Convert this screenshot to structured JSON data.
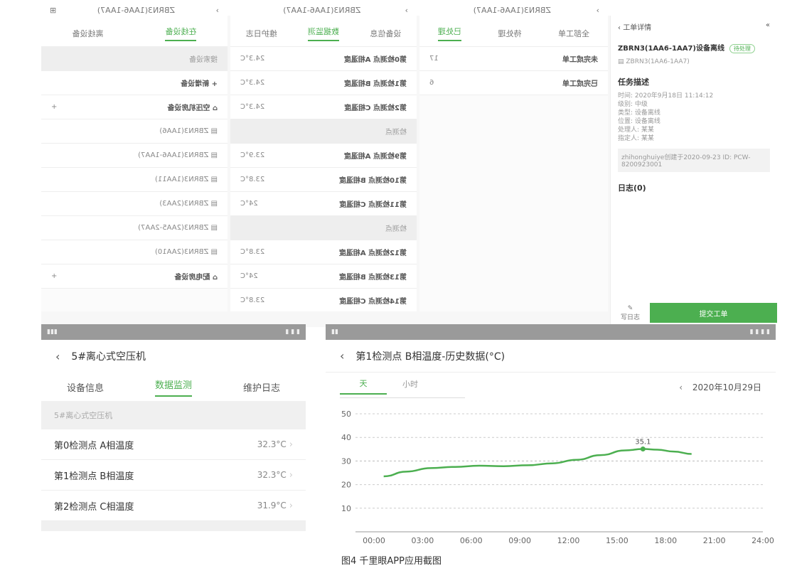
{
  "caption": "图4 千里眼APP应用截图",
  "top_detail": {
    "header": "工单详情",
    "device": "ZBRN3(1AA6-1AA7)设备离线",
    "tag": "待处理",
    "subtitle": "ZBRN3(1AA6-1AA7)",
    "section_desc": "任务描述",
    "desc_lines": [
      "时间: 2020年9月18日 11:14:12",
      "级别: 中级",
      "类型: 设备离线",
      "位置: 设备离线",
      "处理人: 某某",
      "指定人: 某某"
    ],
    "record": "zhihonghuiye创建于2020-09-23 ID: PCW-8200923001",
    "log_label": "日志(0)",
    "edit_label": "写日志",
    "submit_label": "提交工单"
  },
  "left_panel": {
    "title": "5#离心式空压机",
    "tabs": [
      "设备信息",
      "数据监测",
      "维护日志"
    ],
    "active_tab": 1,
    "group_label": "5#离心式空压机",
    "rows": [
      {
        "name": "第0检测点 A相温度",
        "value": "32.3°C"
      },
      {
        "name": "第1检测点 B相温度",
        "value": "32.3°C"
      },
      {
        "name": "第2检测点 C相温度",
        "value": "31.9°C"
      }
    ]
  },
  "right_panel": {
    "title": "第1检测点 B相温度-历史数据(°C)",
    "segments": [
      "天",
      "小时"
    ],
    "active_segment": 0,
    "date": "2020年10月29日"
  },
  "chart_data": {
    "type": "line",
    "x": [
      "00:00",
      "03:00",
      "06:00",
      "09:00",
      "12:00",
      "15:00",
      "18:00",
      "21:00",
      "24:00"
    ],
    "x_values": [
      0,
      3,
      6,
      9,
      12,
      15,
      18,
      21,
      24
    ],
    "series": [
      {
        "x": [
          0.6,
          2,
          3.5,
          5,
          6.5,
          8,
          9.5,
          11,
          12.5,
          14,
          15.5,
          16.6,
          17.5,
          18.5,
          19.6
        ],
        "values": [
          23.5,
          25.5,
          27,
          27.5,
          28,
          27.8,
          28.2,
          29,
          30.5,
          32.5,
          34.5,
          35.1,
          34.8,
          34,
          33
        ]
      }
    ],
    "annotation": {
      "x": 16.6,
      "y": 35.1,
      "label": "35.1"
    },
    "ylim": [
      0,
      50
    ],
    "xlim": [
      0,
      24
    ],
    "yticks": [
      10,
      20,
      30,
      40,
      50
    ],
    "color": "#4caf50",
    "grid": true
  }
}
